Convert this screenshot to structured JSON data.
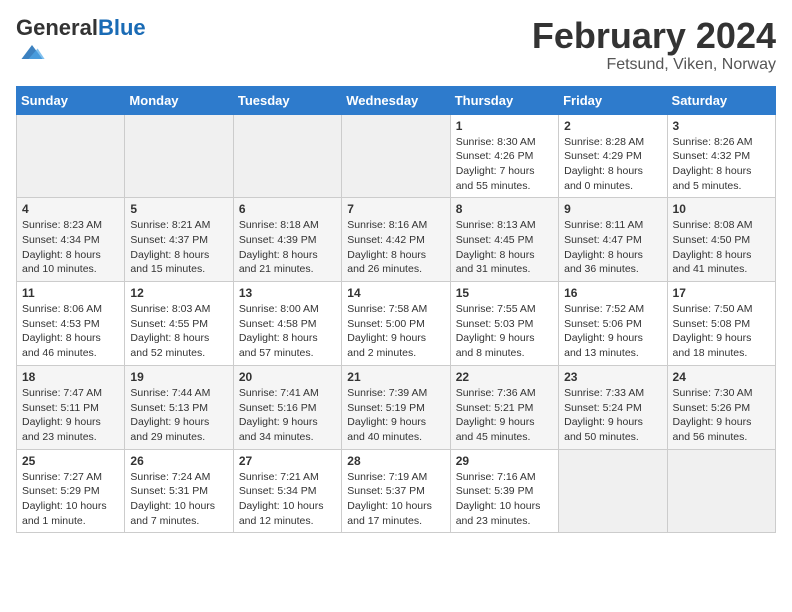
{
  "header": {
    "logo_general": "General",
    "logo_blue": "Blue",
    "month_title": "February 2024",
    "location": "Fetsund, Viken, Norway"
  },
  "days_of_week": [
    "Sunday",
    "Monday",
    "Tuesday",
    "Wednesday",
    "Thursday",
    "Friday",
    "Saturday"
  ],
  "weeks": [
    [
      {
        "day": "",
        "info": ""
      },
      {
        "day": "",
        "info": ""
      },
      {
        "day": "",
        "info": ""
      },
      {
        "day": "",
        "info": ""
      },
      {
        "day": "1",
        "info": "Sunrise: 8:30 AM\nSunset: 4:26 PM\nDaylight: 7 hours\nand 55 minutes."
      },
      {
        "day": "2",
        "info": "Sunrise: 8:28 AM\nSunset: 4:29 PM\nDaylight: 8 hours\nand 0 minutes."
      },
      {
        "day": "3",
        "info": "Sunrise: 8:26 AM\nSunset: 4:32 PM\nDaylight: 8 hours\nand 5 minutes."
      }
    ],
    [
      {
        "day": "4",
        "info": "Sunrise: 8:23 AM\nSunset: 4:34 PM\nDaylight: 8 hours\nand 10 minutes."
      },
      {
        "day": "5",
        "info": "Sunrise: 8:21 AM\nSunset: 4:37 PM\nDaylight: 8 hours\nand 15 minutes."
      },
      {
        "day": "6",
        "info": "Sunrise: 8:18 AM\nSunset: 4:39 PM\nDaylight: 8 hours\nand 21 minutes."
      },
      {
        "day": "7",
        "info": "Sunrise: 8:16 AM\nSunset: 4:42 PM\nDaylight: 8 hours\nand 26 minutes."
      },
      {
        "day": "8",
        "info": "Sunrise: 8:13 AM\nSunset: 4:45 PM\nDaylight: 8 hours\nand 31 minutes."
      },
      {
        "day": "9",
        "info": "Sunrise: 8:11 AM\nSunset: 4:47 PM\nDaylight: 8 hours\nand 36 minutes."
      },
      {
        "day": "10",
        "info": "Sunrise: 8:08 AM\nSunset: 4:50 PM\nDaylight: 8 hours\nand 41 minutes."
      }
    ],
    [
      {
        "day": "11",
        "info": "Sunrise: 8:06 AM\nSunset: 4:53 PM\nDaylight: 8 hours\nand 46 minutes."
      },
      {
        "day": "12",
        "info": "Sunrise: 8:03 AM\nSunset: 4:55 PM\nDaylight: 8 hours\nand 52 minutes."
      },
      {
        "day": "13",
        "info": "Sunrise: 8:00 AM\nSunset: 4:58 PM\nDaylight: 8 hours\nand 57 minutes."
      },
      {
        "day": "14",
        "info": "Sunrise: 7:58 AM\nSunset: 5:00 PM\nDaylight: 9 hours\nand 2 minutes."
      },
      {
        "day": "15",
        "info": "Sunrise: 7:55 AM\nSunset: 5:03 PM\nDaylight: 9 hours\nand 8 minutes."
      },
      {
        "day": "16",
        "info": "Sunrise: 7:52 AM\nSunset: 5:06 PM\nDaylight: 9 hours\nand 13 minutes."
      },
      {
        "day": "17",
        "info": "Sunrise: 7:50 AM\nSunset: 5:08 PM\nDaylight: 9 hours\nand 18 minutes."
      }
    ],
    [
      {
        "day": "18",
        "info": "Sunrise: 7:47 AM\nSunset: 5:11 PM\nDaylight: 9 hours\nand 23 minutes."
      },
      {
        "day": "19",
        "info": "Sunrise: 7:44 AM\nSunset: 5:13 PM\nDaylight: 9 hours\nand 29 minutes."
      },
      {
        "day": "20",
        "info": "Sunrise: 7:41 AM\nSunset: 5:16 PM\nDaylight: 9 hours\nand 34 minutes."
      },
      {
        "day": "21",
        "info": "Sunrise: 7:39 AM\nSunset: 5:19 PM\nDaylight: 9 hours\nand 40 minutes."
      },
      {
        "day": "22",
        "info": "Sunrise: 7:36 AM\nSunset: 5:21 PM\nDaylight: 9 hours\nand 45 minutes."
      },
      {
        "day": "23",
        "info": "Sunrise: 7:33 AM\nSunset: 5:24 PM\nDaylight: 9 hours\nand 50 minutes."
      },
      {
        "day": "24",
        "info": "Sunrise: 7:30 AM\nSunset: 5:26 PM\nDaylight: 9 hours\nand 56 minutes."
      }
    ],
    [
      {
        "day": "25",
        "info": "Sunrise: 7:27 AM\nSunset: 5:29 PM\nDaylight: 10 hours\nand 1 minute."
      },
      {
        "day": "26",
        "info": "Sunrise: 7:24 AM\nSunset: 5:31 PM\nDaylight: 10 hours\nand 7 minutes."
      },
      {
        "day": "27",
        "info": "Sunrise: 7:21 AM\nSunset: 5:34 PM\nDaylight: 10 hours\nand 12 minutes."
      },
      {
        "day": "28",
        "info": "Sunrise: 7:19 AM\nSunset: 5:37 PM\nDaylight: 10 hours\nand 17 minutes."
      },
      {
        "day": "29",
        "info": "Sunrise: 7:16 AM\nSunset: 5:39 PM\nDaylight: 10 hours\nand 23 minutes."
      },
      {
        "day": "",
        "info": ""
      },
      {
        "day": "",
        "info": ""
      }
    ]
  ]
}
